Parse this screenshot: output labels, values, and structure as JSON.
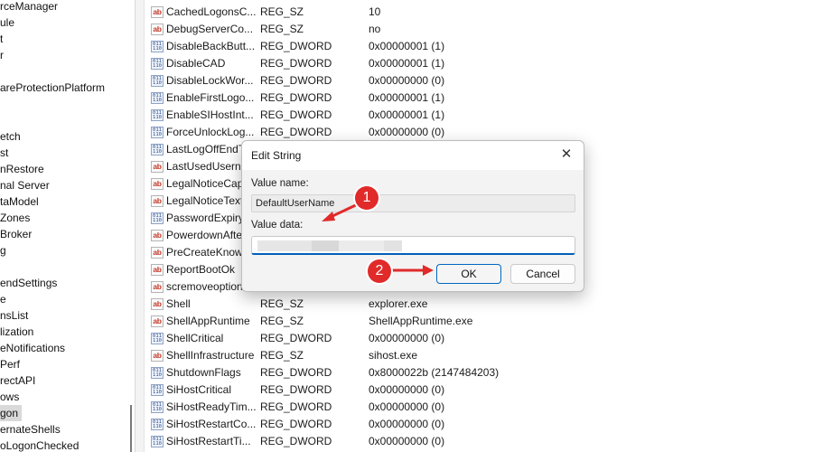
{
  "tree": {
    "items": [
      {
        "label": "rceManager",
        "selected": false
      },
      {
        "label": "ule",
        "selected": false
      },
      {
        "label": "t",
        "selected": false
      },
      {
        "label": "r",
        "selected": false
      },
      {
        "label": "",
        "selected": false
      },
      {
        "label": "areProtectionPlatform",
        "selected": false
      },
      {
        "label": "",
        "selected": false
      },
      {
        "label": "",
        "selected": false
      },
      {
        "label": "etch",
        "selected": false
      },
      {
        "label": "st",
        "selected": false
      },
      {
        "label": "nRestore",
        "selected": false
      },
      {
        "label": "nal Server",
        "selected": false
      },
      {
        "label": "taModel",
        "selected": false
      },
      {
        "label": "Zones",
        "selected": false
      },
      {
        "label": "Broker",
        "selected": false
      },
      {
        "label": "g",
        "selected": false
      },
      {
        "label": "",
        "selected": false
      },
      {
        "label": "endSettings",
        "selected": false
      },
      {
        "label": "e",
        "selected": false
      },
      {
        "label": "nsList",
        "selected": false
      },
      {
        "label": "lization",
        "selected": false
      },
      {
        "label": "eNotifications",
        "selected": false
      },
      {
        "label": "Perf",
        "selected": false
      },
      {
        "label": "rectAPI",
        "selected": false
      },
      {
        "label": "ows",
        "selected": false
      },
      {
        "label": "gon",
        "selected": true
      },
      {
        "label": "ernateShells",
        "selected": false
      },
      {
        "label": "oLogonChecked",
        "selected": false
      }
    ]
  },
  "values": {
    "rows": [
      {
        "name": "CachedLogonsC...",
        "type": "REG_SZ",
        "data": "10",
        "icon": "string-value-icon"
      },
      {
        "name": "DebugServerCo...",
        "type": "REG_SZ",
        "data": "no",
        "icon": "string-value-icon"
      },
      {
        "name": "DisableBackButt...",
        "type": "REG_DWORD",
        "data": "0x00000001 (1)",
        "icon": "dword-value-icon"
      },
      {
        "name": "DisableCAD",
        "type": "REG_DWORD",
        "data": "0x00000001 (1)",
        "icon": "dword-value-icon"
      },
      {
        "name": "DisableLockWor...",
        "type": "REG_DWORD",
        "data": "0x00000000 (0)",
        "icon": "dword-value-icon"
      },
      {
        "name": "EnableFirstLogo...",
        "type": "REG_DWORD",
        "data": "0x00000001 (1)",
        "icon": "dword-value-icon"
      },
      {
        "name": "EnableSIHostInt...",
        "type": "REG_DWORD",
        "data": "0x00000001 (1)",
        "icon": "dword-value-icon"
      },
      {
        "name": "ForceUnlockLog...",
        "type": "REG_DWORD",
        "data": "0x00000000 (0)",
        "icon": "dword-value-icon"
      },
      {
        "name": "LastLogOffEndT",
        "type": "",
        "data": "",
        "icon": "dword-value-icon"
      },
      {
        "name": "LastUsedUserna",
        "type": "",
        "data": "",
        "icon": "string-value-icon"
      },
      {
        "name": "LegalNoticeCap",
        "type": "",
        "data": "",
        "icon": "string-value-icon"
      },
      {
        "name": "LegalNoticeText",
        "type": "",
        "data": "",
        "icon": "string-value-icon"
      },
      {
        "name": "PasswordExpiry",
        "type": "",
        "data": "",
        "icon": "dword-value-icon"
      },
      {
        "name": "PowerdownAfte",
        "type": "",
        "data": "",
        "icon": "string-value-icon"
      },
      {
        "name": "PreCreateKnow",
        "type": "",
        "data": "",
        "icon": "string-value-icon"
      },
      {
        "name": "ReportBootOk",
        "type": "",
        "data": "",
        "icon": "string-value-icon"
      },
      {
        "name": "scremoveoption",
        "type": "",
        "data": "",
        "icon": "string-value-icon"
      },
      {
        "name": "Shell",
        "type": "REG_SZ",
        "data": "explorer.exe",
        "icon": "string-value-icon"
      },
      {
        "name": "ShellAppRuntime",
        "type": "REG_SZ",
        "data": "ShellAppRuntime.exe",
        "icon": "string-value-icon"
      },
      {
        "name": "ShellCritical",
        "type": "REG_DWORD",
        "data": "0x00000000 (0)",
        "icon": "dword-value-icon"
      },
      {
        "name": "ShellInfrastructure",
        "type": "REG_SZ",
        "data": "sihost.exe",
        "icon": "string-value-icon"
      },
      {
        "name": "ShutdownFlags",
        "type": "REG_DWORD",
        "data": "0x8000022b (2147484203)",
        "icon": "dword-value-icon"
      },
      {
        "name": "SiHostCritical",
        "type": "REG_DWORD",
        "data": "0x00000000 (0)",
        "icon": "dword-value-icon"
      },
      {
        "name": "SiHostReadyTim...",
        "type": "REG_DWORD",
        "data": "0x00000000 (0)",
        "icon": "dword-value-icon"
      },
      {
        "name": "SiHostRestartCo...",
        "type": "REG_DWORD",
        "data": "0x00000000 (0)",
        "icon": "dword-value-icon"
      },
      {
        "name": "SiHostRestartTi...",
        "type": "REG_DWORD",
        "data": "0x00000000 (0)",
        "icon": "dword-value-icon"
      }
    ]
  },
  "dialog": {
    "title": "Edit String",
    "close_glyph": "✕",
    "value_name_label": "Value name:",
    "value_name": "DefaultUserName",
    "value_data_label": "Value data:",
    "value_data": "",
    "ok_label": "OK",
    "cancel_label": "Cancel"
  },
  "annotations": {
    "step1": "1",
    "step2": "2",
    "color": "#e12a2a"
  },
  "icons": {
    "string_glyph": "ab",
    "dword_glyph": "011\n110"
  }
}
